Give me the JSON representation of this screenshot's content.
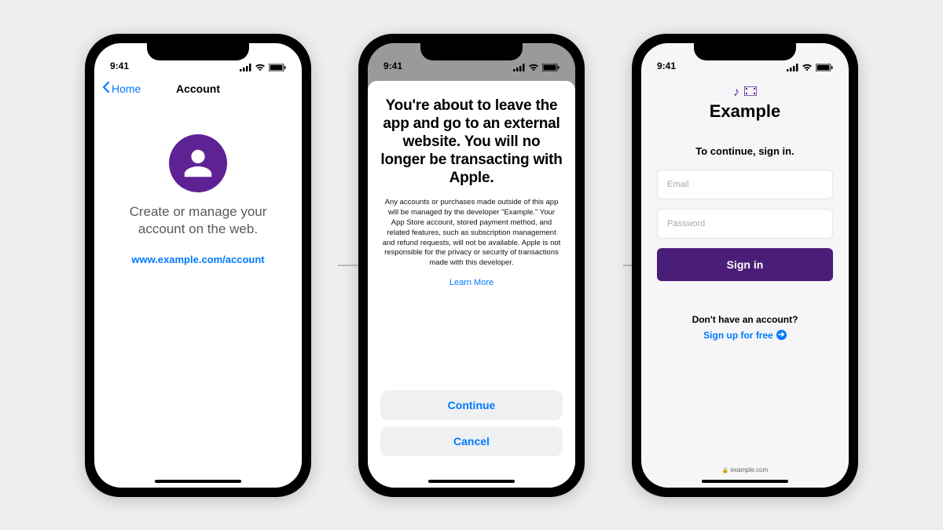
{
  "status": {
    "time": "9:41"
  },
  "phone1": {
    "back_label": "Home",
    "title": "Account",
    "message": "Create or manage your account on the web.",
    "link": "www.example.com/account"
  },
  "phone2": {
    "title": "You're about to leave the app and go to an external website. You will no longer be transacting with Apple.",
    "body": "Any accounts or purchases made outside of this app will be managed by the developer \"Example.\" Your App Store account, stored payment method, and related features, such as subscription management and refund requests, will not be available. Apple is not responsible for the privacy or security of transactions made with this developer.",
    "learn_more": "Learn More",
    "continue": "Continue",
    "cancel": "Cancel"
  },
  "phone3": {
    "brand": "Example",
    "prompt": "To continue, sign in.",
    "email_placeholder": "Email",
    "password_placeholder": "Password",
    "signin": "Sign in",
    "no_account": "Don't have an account?",
    "signup": "Sign up for free",
    "url": "example.com"
  }
}
